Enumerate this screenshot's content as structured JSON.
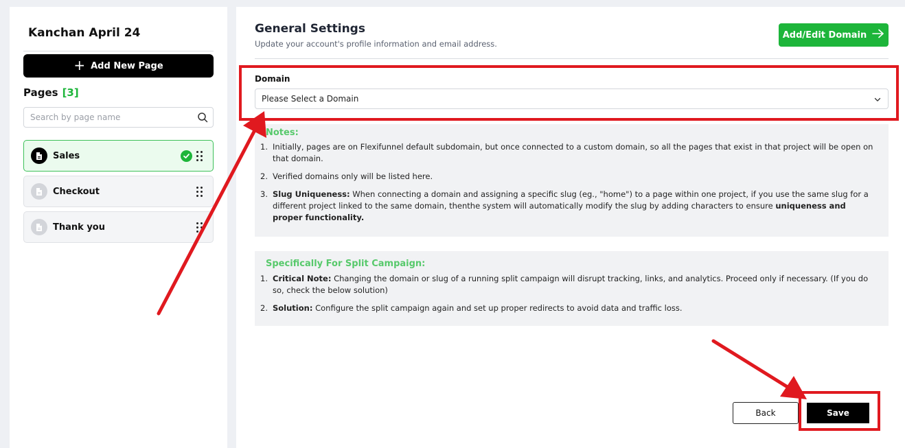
{
  "sidebar": {
    "project_title": "Kanchan April 24",
    "add_page_label": "Add New Page",
    "pages_heading": "Pages",
    "pages_count": "[3]",
    "search_placeholder": "Search by page name",
    "pages": [
      {
        "label": "Sales",
        "active": true,
        "verified": true
      },
      {
        "label": "Checkout",
        "active": false,
        "verified": false
      },
      {
        "label": "Thank you",
        "active": false,
        "verified": false
      }
    ]
  },
  "main": {
    "title": "General Settings",
    "subtitle": "Update your account's profile information and email address.",
    "domain_button_label": "Add/Edit Domain",
    "domain_label": "Domain",
    "domain_select_value": "Please Select a Domain",
    "notes": {
      "heading": "Notes:",
      "items": [
        {
          "num": "1.",
          "bold": "",
          "text": "Initially, pages are on Flexifunnel default subdomain, but once connected to a custom domain, so all the pages that exist in that project will be open on that domain."
        },
        {
          "num": "2.",
          "bold": "",
          "text": "Verified domains only will be listed here."
        },
        {
          "num": "3.",
          "bold": "Slug Uniqueness:",
          "text": " When connecting a domain and assigning a specific slug (eg., \"home\") to a page within one project, if you use the same slug for a different project linked to the same domain, thenthe system will automatically modify the slug by adding characters to ensure ",
          "bold_end": "uniqueness and proper functionality."
        }
      ]
    },
    "split": {
      "heading": "Specifically For Split Campaign:",
      "items": [
        {
          "num": "1.",
          "bold": "Critical Note:",
          "text": " Changing the domain or slug of a running split campaign will disrupt tracking, links, and analytics. Proceed only if necessary. (If you do so, check the below solution)"
        },
        {
          "num": "2.",
          "bold": "Solution:",
          "text": " Configure the split campaign again and set up proper redirects to avoid data and traffic loss."
        }
      ]
    },
    "back_label": "Back",
    "save_label": "Save"
  },
  "colors": {
    "accent_green": "#1db53a",
    "note_heading_green": "#57c96b",
    "annotation_red": "#e0191f"
  }
}
